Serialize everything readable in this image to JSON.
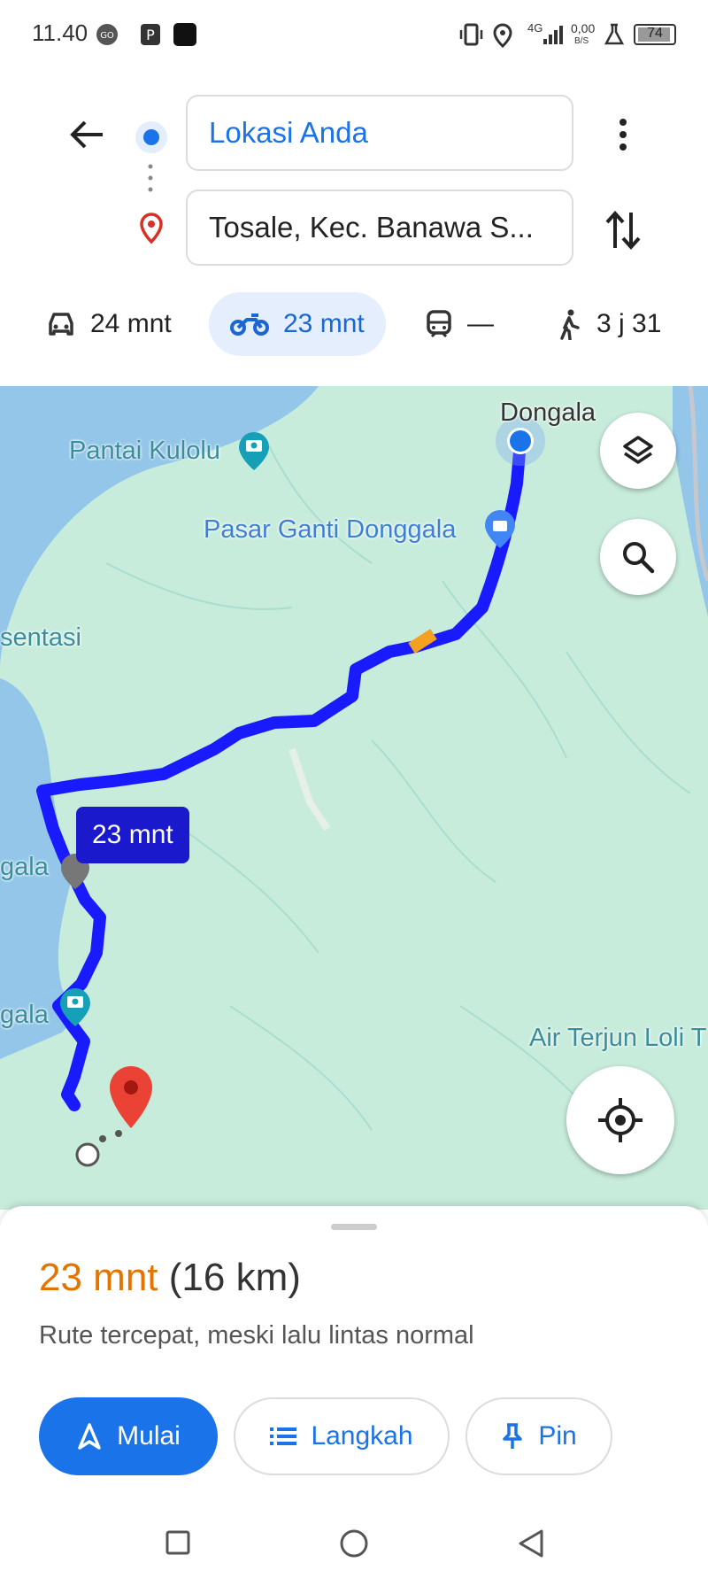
{
  "status_bar": {
    "time": "11.40",
    "network": "4G",
    "speed_value": "0,00",
    "speed_unit": "B/S",
    "battery": "74"
  },
  "header": {
    "origin": "Lokasi Anda",
    "destination": "Tosale, Kec. Banawa S..."
  },
  "modes": [
    {
      "name": "car",
      "label": "24 mnt"
    },
    {
      "name": "motorcycle",
      "label": "23 mnt",
      "active": true
    },
    {
      "name": "transit",
      "label": "—"
    },
    {
      "name": "walk",
      "label": "3 j 31"
    }
  ],
  "map": {
    "labels": {
      "dongala": "Dongala",
      "pantai_kulolu": "Pantai Kulolu",
      "pasar_ganti": "Pasar Ganti Donggala",
      "sentasi": "sentasi",
      "gala1": "gala",
      "gala2": "gala",
      "air_terjun": "Air Terjun Loli T"
    },
    "route_time": "23 mnt",
    "route_color": "#1a1aff",
    "traffic_color": "#f4a020"
  },
  "sheet": {
    "duration": "23 mnt",
    "distance": "(16 km)",
    "description": "Rute tercepat, meski lalu lintas normal",
    "start_label": "Mulai",
    "steps_label": "Langkah",
    "pin_label": "Pin"
  },
  "colors": {
    "accent": "#1a73e8",
    "duration": "#e37400",
    "map_land": "#c8ecdc",
    "map_water": "#93c6e8"
  }
}
